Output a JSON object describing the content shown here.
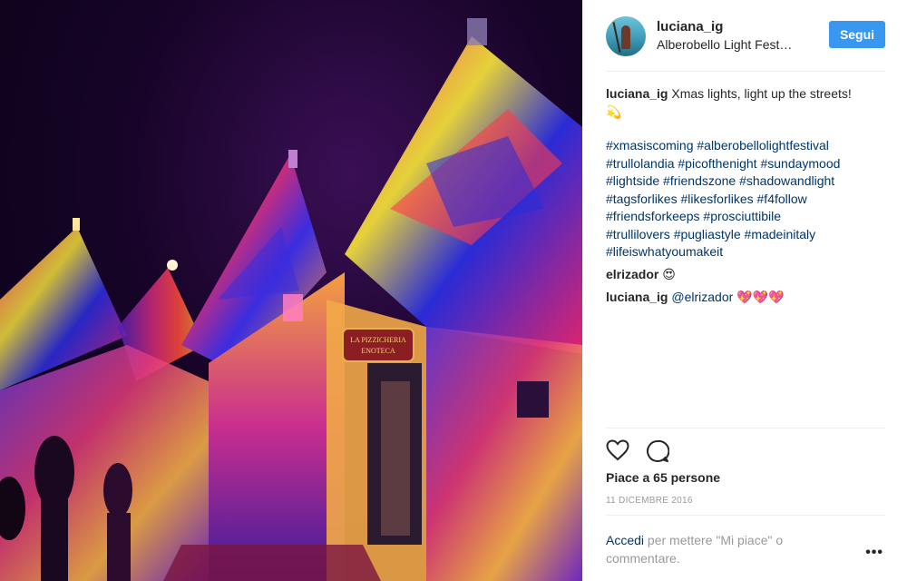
{
  "post": {
    "username": "luciana_ig",
    "location": "Alberobello Light Fest…",
    "follow_label": "Segui"
  },
  "caption": {
    "username": "luciana_ig",
    "text": "Xmas lights, light up the streets!",
    "emoji": "💫",
    "hashtags": [
      "#xmasiscoming",
      "#alberobellolightfestival",
      "#trullolandia",
      "#picofthenight",
      "#sundaymood",
      "#lightside",
      "#friendszone",
      "#shadowandlight",
      "#tagsforlikes",
      "#likesforlikes",
      "#f4follow",
      "#friendsforkeeps",
      "#prosciuttibile",
      "#trullilovers",
      "#pugliastyle",
      "#madeinitaly",
      "#lifeiswhatyoumakeit"
    ]
  },
  "comments": [
    {
      "username": "elrizador",
      "text": "",
      "emoji": "😍"
    },
    {
      "username": "luciana_ig",
      "text": "@elrizador",
      "emoji": "💖💖💖"
    }
  ],
  "actions": {
    "like_icon": "heart-icon",
    "comment_icon": "comment-icon"
  },
  "likes_text": "Piace a 65 persone",
  "date": "11 DICEMBRE 2016",
  "login_prompt": {
    "link": "Accedi",
    "rest": " per mettere \"Mi piace\" o commentare."
  },
  "more_icon": "•••",
  "photo": {
    "sign_text": "LA PIZZICHERIA ENOTECA"
  },
  "colors": {
    "accent": "#3897f0",
    "link": "#003569",
    "muted": "#999999"
  }
}
